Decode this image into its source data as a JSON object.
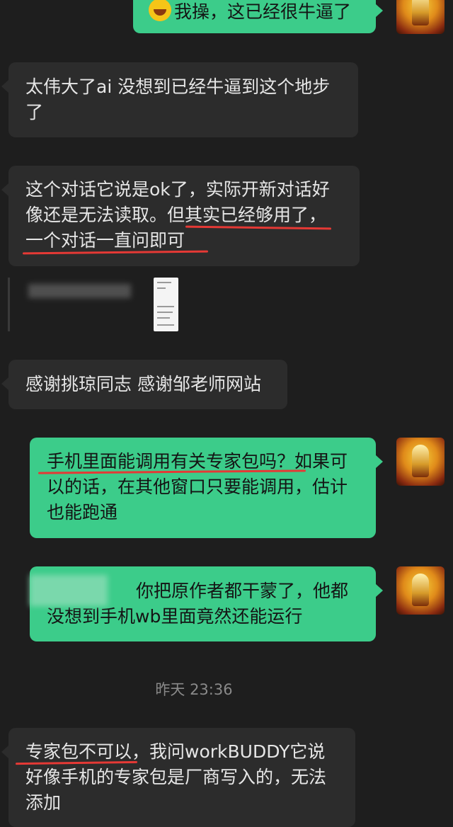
{
  "messages": {
    "m1": {
      "text": "我操，这已经很牛逼了"
    },
    "m2": {
      "text": "太伟大了ai 没想到已经牛逼到这个地步了"
    },
    "m3": {
      "text": "这个对话它说是ok了，实际开新对话好像还是无法读取。但其实已经够用了，一个对话一直问即可"
    },
    "m4": {
      "text": "感谢挑琼同志 感谢邹老师网站"
    },
    "m5": {
      "text": "手机里面能调用有关专家包吗？如果可以的话，在其他窗口只要能调用，估计也能跑通"
    },
    "m6": {
      "text": "你把原作者都干蒙了，他都没想到手机wb里面竟然还能运行"
    },
    "m7": {
      "text": "专家包不可以，我问workBUDDY它说好像手机的专家包是厂商写入的，无法添加"
    }
  },
  "timestamp": "昨天 23:36",
  "colors": {
    "background": "#1e1e1e",
    "incoming_bubble": "#2c2c2c",
    "outgoing_bubble": "#3ccc8a",
    "underline": "#e53935"
  }
}
